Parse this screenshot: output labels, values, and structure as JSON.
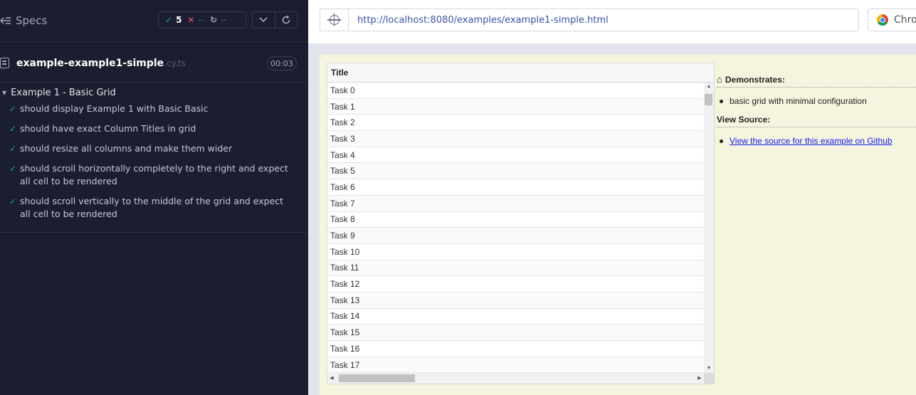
{
  "runner": {
    "specs_label": "Specs",
    "stats": {
      "passed": "5",
      "failed": "--",
      "pending": "--"
    },
    "spec": {
      "name": "example-example1-simple",
      "ext": ".cy.ts",
      "duration": "00:03"
    },
    "suite": {
      "title": "Example 1 - Basic Grid",
      "tests": [
        "should display Example 1 with Basic Basic",
        "should have exact Column Titles in grid",
        "should resize all columns and make them wider",
        "should scroll horizontally completely to the right and expect all cell to be rendered",
        "should scroll vertically to the middle of the grid and expect all cell to be rendered"
      ]
    }
  },
  "aut": {
    "url": "http://localhost:8080/examples/example1-simple.html",
    "browser": "Chro",
    "grid": {
      "column_title": "Title",
      "rows": [
        "Task 0",
        "Task 1",
        "Task 2",
        "Task 3",
        "Task 4",
        "Task 5",
        "Task 6",
        "Task 7",
        "Task 8",
        "Task 9",
        "Task 10",
        "Task 11",
        "Task 12",
        "Task 13",
        "Task 14",
        "Task 15",
        "Task 16",
        "Task 17"
      ]
    },
    "info": {
      "demonstrates_title": "Demonstrates:",
      "demonstrates_item": "basic grid with minimal configuration",
      "view_source_title": "View Source:",
      "view_source_link": "View the source for this example on Github"
    }
  },
  "colors": {
    "runner_bg": "#1b1e2e",
    "pass": "#1fa971",
    "fail": "#e45770",
    "viewport_bg": "#f4f4df",
    "link": "#1a1aee"
  },
  "icons": [
    "specs-icon",
    "check-icon",
    "x-icon",
    "pending-icon",
    "chevron-down-icon",
    "reload-icon",
    "file-icon",
    "crosshair-icon",
    "chrome-icon",
    "home-icon"
  ]
}
